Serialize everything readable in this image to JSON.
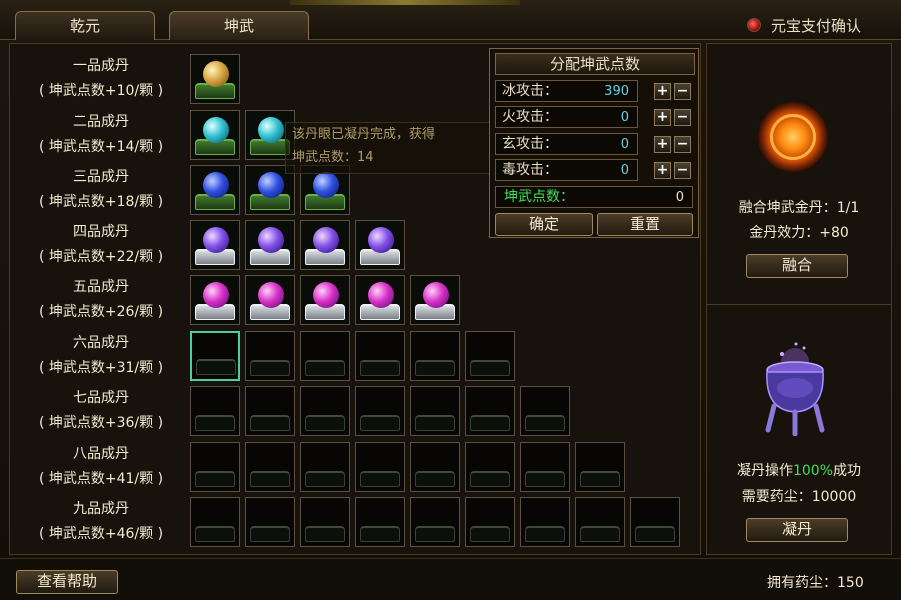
{
  "tabs": [
    {
      "label": "乾元"
    },
    {
      "label": "坤武"
    }
  ],
  "payment": {
    "label": "元宝支付确认"
  },
  "rows": [
    {
      "name": "一品成丹",
      "bonus": "( 坤武点数+10/颗 )",
      "total": 1,
      "filled": 1,
      "orb": "gold",
      "tray": "green"
    },
    {
      "name": "二品成丹",
      "bonus": "( 坤武点数+14/颗 )",
      "total": 2,
      "filled": 2,
      "orb": "cyan",
      "tray": "green"
    },
    {
      "name": "三品成丹",
      "bonus": "( 坤武点数+18/颗 )",
      "total": 3,
      "filled": 3,
      "orb": "blue",
      "tray": "green"
    },
    {
      "name": "四品成丹",
      "bonus": "( 坤武点数+22/颗 )",
      "total": 4,
      "filled": 4,
      "orb": "violet",
      "tray": "silver"
    },
    {
      "name": "五品成丹",
      "bonus": "( 坤武点数+26/颗 )",
      "total": 5,
      "filled": 5,
      "orb": "magenta",
      "tray": "silver"
    },
    {
      "name": "六品成丹",
      "bonus": "( 坤武点数+31/颗 )",
      "total": 6,
      "filled": 0,
      "orb": "",
      "tray": "dark"
    },
    {
      "name": "七品成丹",
      "bonus": "( 坤武点数+36/颗 )",
      "total": 7,
      "filled": 0,
      "orb": "",
      "tray": "dark"
    },
    {
      "name": "八品成丹",
      "bonus": "( 坤武点数+41/颗 )",
      "total": 8,
      "filled": 0,
      "orb": "",
      "tray": "dark"
    },
    {
      "name": "九品成丹",
      "bonus": "( 坤武点数+46/颗 )",
      "total": 9,
      "filled": 0,
      "orb": "",
      "tray": "dark"
    }
  ],
  "tooltip": {
    "line1": "该丹眼已凝丹完成，获得",
    "line2": "坤武点数：14"
  },
  "allocation": {
    "title": "分配坤武点数",
    "attacks": [
      {
        "label": "冰攻击：",
        "value": "390"
      },
      {
        "label": "火攻击：",
        "value": "0"
      },
      {
        "label": "玄攻击：",
        "value": "0"
      },
      {
        "label": "毒攻击：",
        "value": "0"
      }
    ],
    "points_label": "坤武点数：",
    "points_value": "0",
    "confirm_label": "确定",
    "reset_label": "重置"
  },
  "fusion": {
    "golden_pill_label": "融合坤武金丹：1/1",
    "effect_label": "金丹效力：+80",
    "button_label": "融合"
  },
  "refine": {
    "operation_prefix": "凝丹操作",
    "operation_pct": "100%",
    "operation_suffix": "成功",
    "cost_label": "需要药尘：10000",
    "button_label": "凝丹"
  },
  "help_label": "查看帮助",
  "dust_label": "拥有药尘：150"
}
